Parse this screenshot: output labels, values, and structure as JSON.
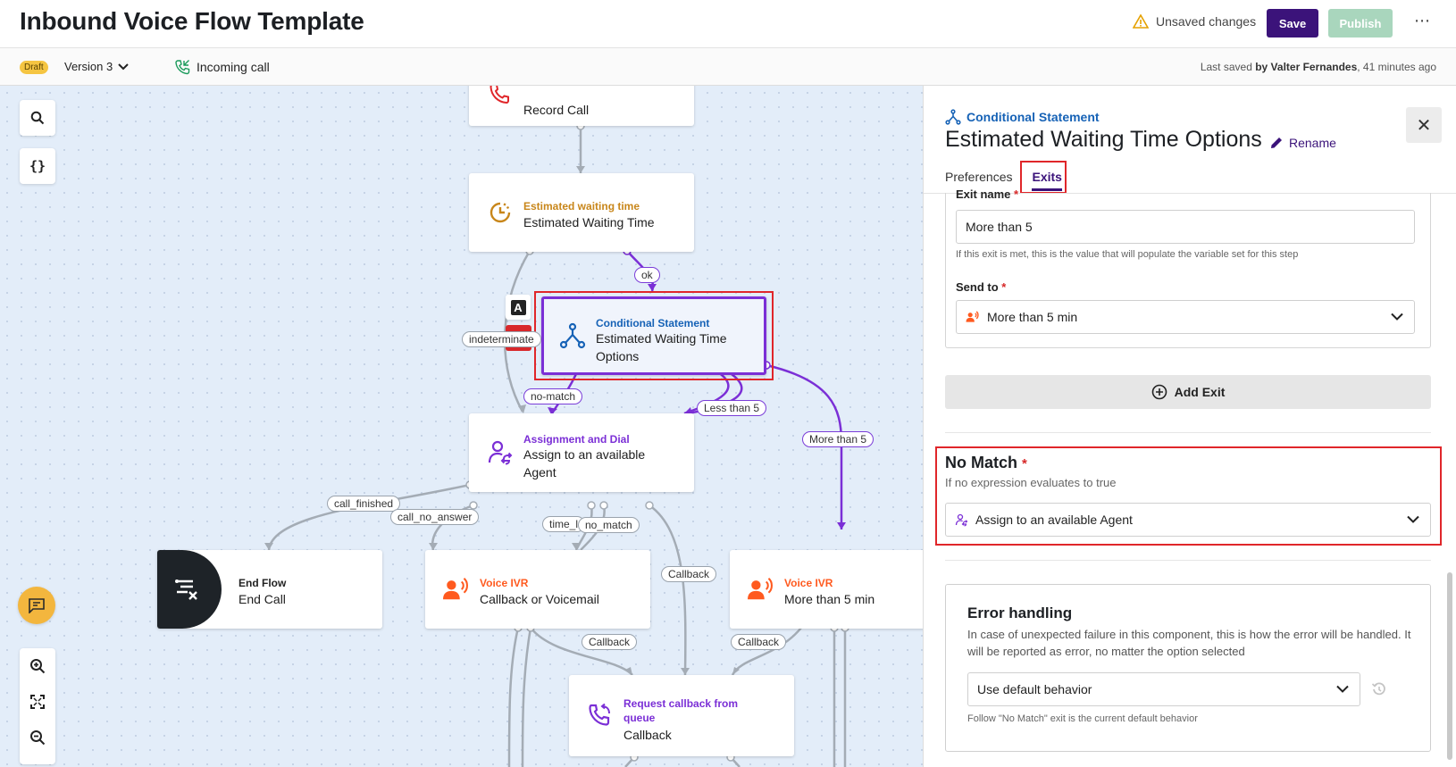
{
  "header": {
    "title": "Inbound Voice Flow Template",
    "unsaved": "Unsaved changes",
    "save": "Save",
    "publish": "Publish"
  },
  "subheader": {
    "status": "Draft",
    "version": "Version 3",
    "trigger": "Incoming call",
    "last_saved_prefix": "Last saved",
    "last_saved_by": "by Valter Fernandes",
    "last_saved_time": ", 41 minutes ago"
  },
  "canvas": {
    "nodes": {
      "record": {
        "name": "Record Call"
      },
      "ewt": {
        "type": "Estimated waiting time",
        "name": "Estimated Waiting Time"
      },
      "cond": {
        "type": "Conditional Statement",
        "name": "Estimated Waiting Time Options"
      },
      "assign": {
        "type": "Assignment and Dial",
        "name": "Assign to an available Agent"
      },
      "endflow": {
        "type": "End Flow",
        "name": "End Call"
      },
      "ivr1": {
        "type": "Voice IVR",
        "name": "Callback or Voicemail"
      },
      "ivr2": {
        "type": "Voice IVR",
        "name": "More than 5 min"
      },
      "callback": {
        "type": "Request callback from queue",
        "name": "Callback"
      }
    },
    "edge_labels": {
      "ok": "ok",
      "indeterminate": "indeterminate",
      "no_match": "no-match",
      "less_than_5": "Less than 5",
      "more_than_5": "More than 5",
      "call_finished": "call_finished",
      "call_no_answer": "call_no_answer",
      "time_limit": "time_l",
      "no_match_2": "no_match",
      "callback_1": "Callback",
      "callback_2": "Callback",
      "callback_3": "Callback"
    },
    "node_badge": "A"
  },
  "panel": {
    "component_type": "Conditional Statement",
    "title": "Estimated Waiting Time Options",
    "rename": "Rename",
    "tabs": [
      "Preferences",
      "Exits"
    ],
    "active_tab": "Exits",
    "exit": {
      "name_label": "Exit name",
      "name_value": "More than 5",
      "name_hint": "If this exit is met, this is the value that will populate the variable set for this step",
      "send_to_label": "Send to",
      "send_to_value": "More than 5 min"
    },
    "add_exit": "Add Exit",
    "no_match": {
      "title": "No Match",
      "description": "If no expression evaluates to true",
      "value": "Assign to an available Agent"
    },
    "error_handling": {
      "title": "Error handling",
      "description": "In case of unexpected failure in this component, this is how the error will be handled. It will be reported as error, no matter the option selected",
      "value": "Use default behavior",
      "hint": "Follow \"No Match\" exit is the current default behavior"
    }
  },
  "colors": {
    "brand": "#3b137a",
    "publish_disabled": "#a9d6bd",
    "highlight": "#e0262a",
    "ivr": "#ff5a1f",
    "assignment": "#7b2fd6",
    "conditional": "#1662b6",
    "ewt": "#c8861a"
  }
}
